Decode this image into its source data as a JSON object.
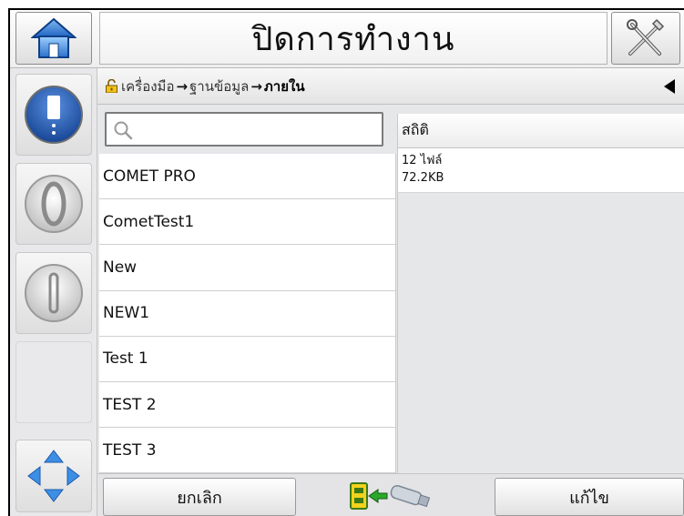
{
  "header": {
    "title": "ปิดการทำงาน",
    "home_icon": "home-icon",
    "tools_icon": "tools-icon"
  },
  "sidebar": {
    "items": [
      {
        "name": "ink-icon",
        "state": "active"
      },
      {
        "name": "start-icon",
        "state": "inactive"
      },
      {
        "name": "stop-icon",
        "state": "inactive"
      },
      {
        "name": "empty",
        "state": "empty"
      },
      {
        "name": "navigation-icon",
        "state": "inactive"
      }
    ]
  },
  "breadcrumb": {
    "segments": [
      "เครื่องมือ",
      "ฐานข้อมูล",
      "ภายใน"
    ],
    "arrow": "→"
  },
  "search": {
    "placeholder": "",
    "value": ""
  },
  "list": {
    "items": [
      "COMET PRO",
      "CometTest1",
      "New",
      "NEW1",
      "Test 1",
      "TEST 2",
      "TEST 3"
    ]
  },
  "stats": {
    "header": "สถิติ",
    "files": "12 ไฟล์",
    "size": "72.2KB"
  },
  "footer": {
    "cancel_label": "ยกเลิก",
    "edit_label": "แก้ไข",
    "transfer_icon": "usb-transfer-icon"
  },
  "colors": {
    "accent_blue": "#1f56a8",
    "background": "#e6e7e9",
    "transfer_green": "#2aa82a"
  }
}
